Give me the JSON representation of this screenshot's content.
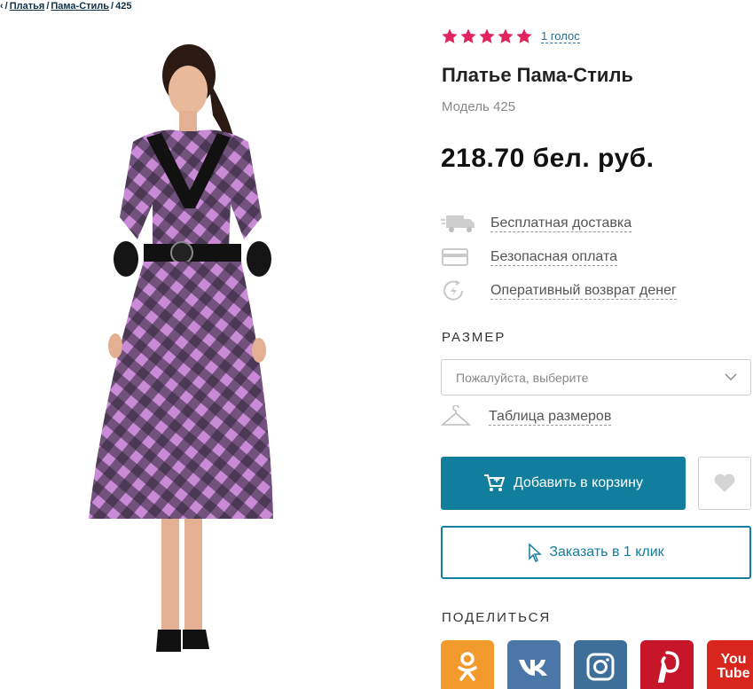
{
  "breadcrumb": {
    "home": "‹",
    "items": [
      "Платья",
      "Пама-Стиль",
      "425"
    ],
    "separator": "/"
  },
  "product": {
    "rating": {
      "stars": 5,
      "max": 5,
      "votes_label": "1 голос",
      "star_color": "#e0245e"
    },
    "title": "Платье Пама-Стиль",
    "model": "Модель 425",
    "price": "218.70 бел. руб.",
    "image_alt_icon": "dress-photo"
  },
  "benefits": [
    {
      "icon": "truck-icon",
      "label": "Бесплатная доставка"
    },
    {
      "icon": "credit-card-icon",
      "label": "Безопасная оплата"
    },
    {
      "icon": "refund-icon",
      "label": "Оперативный возврат денег"
    }
  ],
  "size": {
    "label": "РАЗМЕР",
    "placeholder": "Пожалуйста, выберите",
    "table_label": "Таблица размеров"
  },
  "actions": {
    "cart_label": "Добавить в корзину",
    "one_click_label": "Заказать в 1 клик",
    "accent": "#127e9e"
  },
  "share": {
    "label": "ПОДЕЛИТЬСЯ",
    "networks": [
      {
        "name": "odnoklassniki-icon",
        "color": "#f39a2c"
      },
      {
        "name": "vk-icon",
        "color": "#4b76a8"
      },
      {
        "name": "instagram-icon",
        "color": "#3d6f9a"
      },
      {
        "name": "pinterest-icon",
        "color": "#c7162a"
      },
      {
        "name": "youtube-icon",
        "color": "#d9261c",
        "text_top": "You",
        "text_bottom": "Tube"
      }
    ]
  }
}
